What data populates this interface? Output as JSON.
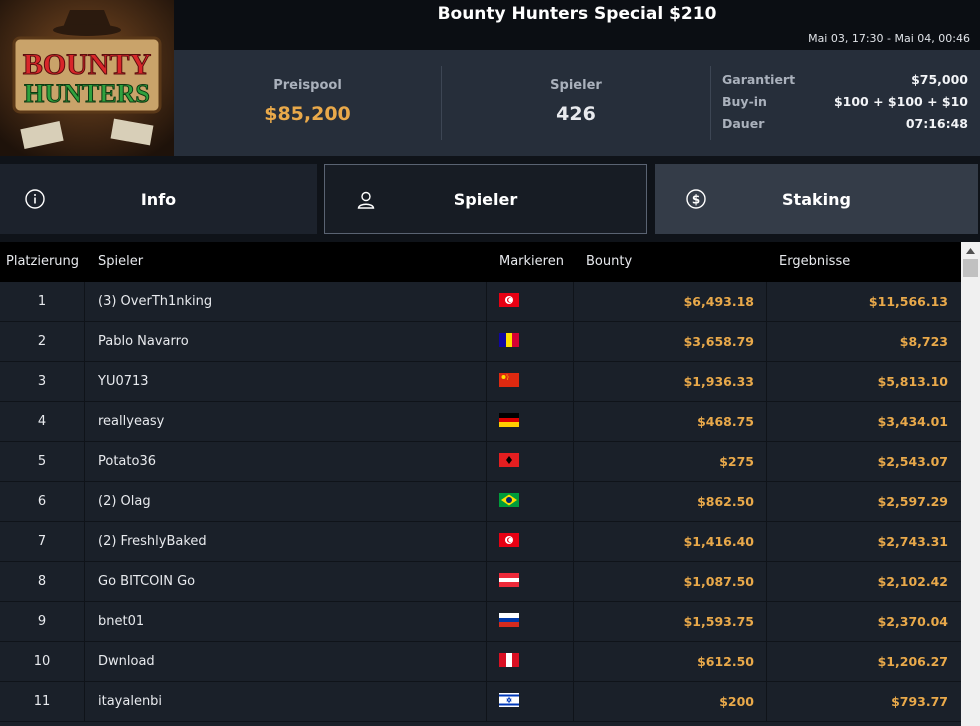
{
  "header": {
    "title": "Bounty Hunters Special $210",
    "date_range": "Mai 03, 17:30 - Mai 04, 00:46",
    "logo_text_line1": "BOUNTY",
    "logo_text_line2": "HUNTERS"
  },
  "stats": {
    "prize_pool_label": "Preispool",
    "prize_pool_value": "$85,200",
    "players_label": "Spieler",
    "players_value": "426",
    "guaranteed_label": "Garantiert",
    "guaranteed_value": "$75,000",
    "buyin_label": "Buy-in",
    "buyin_value": "$100 + $100 + $10",
    "duration_label": "Dauer",
    "duration_value": "07:16:48"
  },
  "tabs": [
    {
      "label": "Info",
      "icon": "info-icon"
    },
    {
      "label": "Spieler",
      "icon": "user-icon"
    },
    {
      "label": "Staking",
      "icon": "dollar-coin-icon"
    }
  ],
  "table": {
    "columns": [
      "Platzierung",
      "Spieler",
      "Markieren",
      "Bounty",
      "Ergebnisse"
    ],
    "rows": [
      {
        "place": "1",
        "name": "(3) OverTh1nking",
        "flag": "tunisia",
        "bounty": "$6,493.18",
        "result": "$11,566.13"
      },
      {
        "place": "2",
        "name": "Pablo Navarro",
        "flag": "andorra",
        "bounty": "$3,658.79",
        "result": "$8,723"
      },
      {
        "place": "3",
        "name": "YU0713",
        "flag": "china",
        "bounty": "$1,936.33",
        "result": "$5,813.10"
      },
      {
        "place": "4",
        "name": "reallyeasy",
        "flag": "germany",
        "bounty": "$468.75",
        "result": "$3,434.01"
      },
      {
        "place": "5",
        "name": "Potato36",
        "flag": "albania",
        "bounty": "$275",
        "result": "$2,543.07"
      },
      {
        "place": "6",
        "name": "(2) Olag",
        "flag": "brazil",
        "bounty": "$862.50",
        "result": "$2,597.29"
      },
      {
        "place": "7",
        "name": "(2) FreshlyBaked",
        "flag": "tunisia",
        "bounty": "$1,416.40",
        "result": "$2,743.31"
      },
      {
        "place": "8",
        "name": "Go BITCOIN Go",
        "flag": "austria",
        "bounty": "$1,087.50",
        "result": "$2,102.42"
      },
      {
        "place": "9",
        "name": "bnet01",
        "flag": "russia",
        "bounty": "$1,593.75",
        "result": "$2,370.04"
      },
      {
        "place": "10",
        "name": "Dwnload",
        "flag": "peru",
        "bounty": "$612.50",
        "result": "$1,206.27"
      },
      {
        "place": "11",
        "name": "itayalenbi",
        "flag": "israel",
        "bounty": "$200",
        "result": "$793.77"
      }
    ]
  },
  "colors": {
    "accent_gold": "#e9a94a",
    "background": "#0f1319",
    "panel": "#262e3a"
  }
}
